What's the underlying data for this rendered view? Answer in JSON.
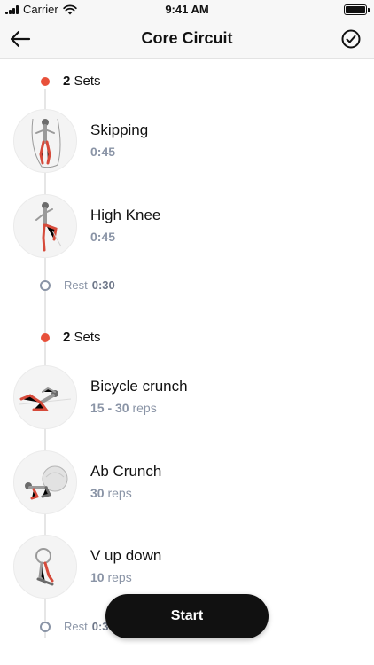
{
  "status_bar": {
    "carrier": "Carrier",
    "time": "9:41 AM"
  },
  "nav": {
    "title": "Core Circuit",
    "back_icon": "back-arrow-icon",
    "done_icon": "check-circle-icon"
  },
  "sections": [
    {
      "sets_count": "2",
      "sets_label": "Sets",
      "exercises": [
        {
          "name": "Skipping",
          "detail_value": "0:45",
          "detail_unit": "",
          "icon": "skipping-figure-icon"
        },
        {
          "name": "High Knee",
          "detail_value": "0:45",
          "detail_unit": "",
          "icon": "high-knee-figure-icon"
        }
      ],
      "rest": {
        "label": "Rest",
        "value": "0:30"
      }
    },
    {
      "sets_count": "2",
      "sets_label": "Sets",
      "exercises": [
        {
          "name": "Bicycle crunch",
          "detail_value": "15 - 30",
          "detail_unit": "reps",
          "icon": "bicycle-crunch-figure-icon"
        },
        {
          "name": "Ab Crunch",
          "detail_value": "30",
          "detail_unit": "reps",
          "icon": "ab-crunch-figure-icon"
        },
        {
          "name": "V up down",
          "detail_value": "10",
          "detail_unit": "reps",
          "icon": "v-up-figure-icon"
        }
      ],
      "rest": {
        "label": "Rest",
        "value": "0:30"
      }
    }
  ],
  "start_button": {
    "label": "Start"
  },
  "colors": {
    "accent_dot": "#e8503a",
    "muted_text": "#8a94a6",
    "button_bg": "#111111"
  }
}
